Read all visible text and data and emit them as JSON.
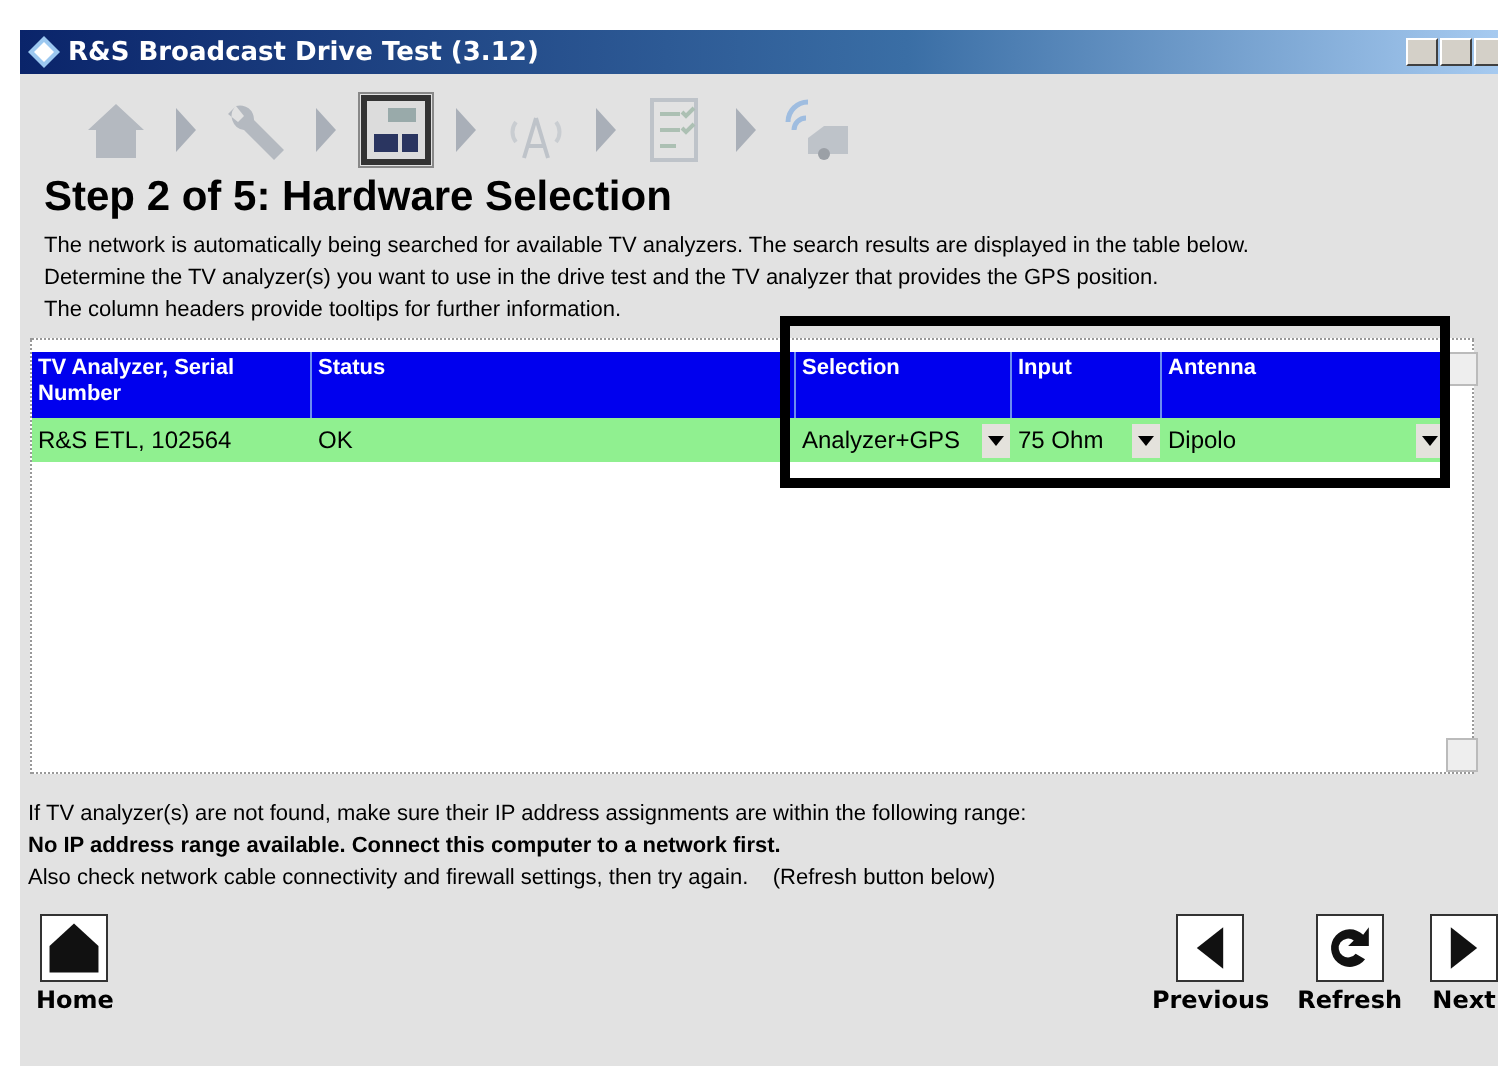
{
  "window": {
    "title": "R&S Broadcast Drive Test (3.12)"
  },
  "steps": [
    {
      "kind": "home",
      "selected": false
    },
    {
      "kind": "wrench",
      "selected": false
    },
    {
      "kind": "analyzer",
      "selected": true
    },
    {
      "kind": "antenna",
      "selected": false
    },
    {
      "kind": "checklist",
      "selected": false
    },
    {
      "kind": "car",
      "selected": false
    }
  ],
  "heading": "Step 2 of 5: Hardware Selection",
  "intro": [
    "The network is automatically being searched for available TV analyzers. The search results are displayed in the table below.",
    "Determine the TV analyzer(s) you want to use in the drive test and the TV analyzer that provides the GPS position.",
    "The column headers provide tooltips for further information."
  ],
  "table": {
    "columns": [
      "TV Analyzer, Serial Number",
      "Status",
      "Selection",
      "Input",
      "Antenna"
    ],
    "rows": [
      {
        "analyzer": "R&S ETL, 102564",
        "status": "OK",
        "selection": "Analyzer+GPS",
        "input": "75 Ohm",
        "antenna": "Dipolo"
      }
    ]
  },
  "notes": [
    {
      "text": "If TV analyzer(s) are not found, make sure their IP address assignments are within the following range:",
      "bold": false
    },
    {
      "text": "No IP address range available. Connect this computer to a network first.",
      "bold": true
    },
    {
      "text": "Also check network cable connectivity and firewall settings, then try again.    (Refresh button below)",
      "bold": false
    }
  ],
  "nav": [
    {
      "kind": "home",
      "label": "Home"
    },
    {
      "kind": "previous",
      "label": "Previous"
    },
    {
      "kind": "refresh",
      "label": "Refresh"
    },
    {
      "kind": "next",
      "label": "Next"
    }
  ]
}
